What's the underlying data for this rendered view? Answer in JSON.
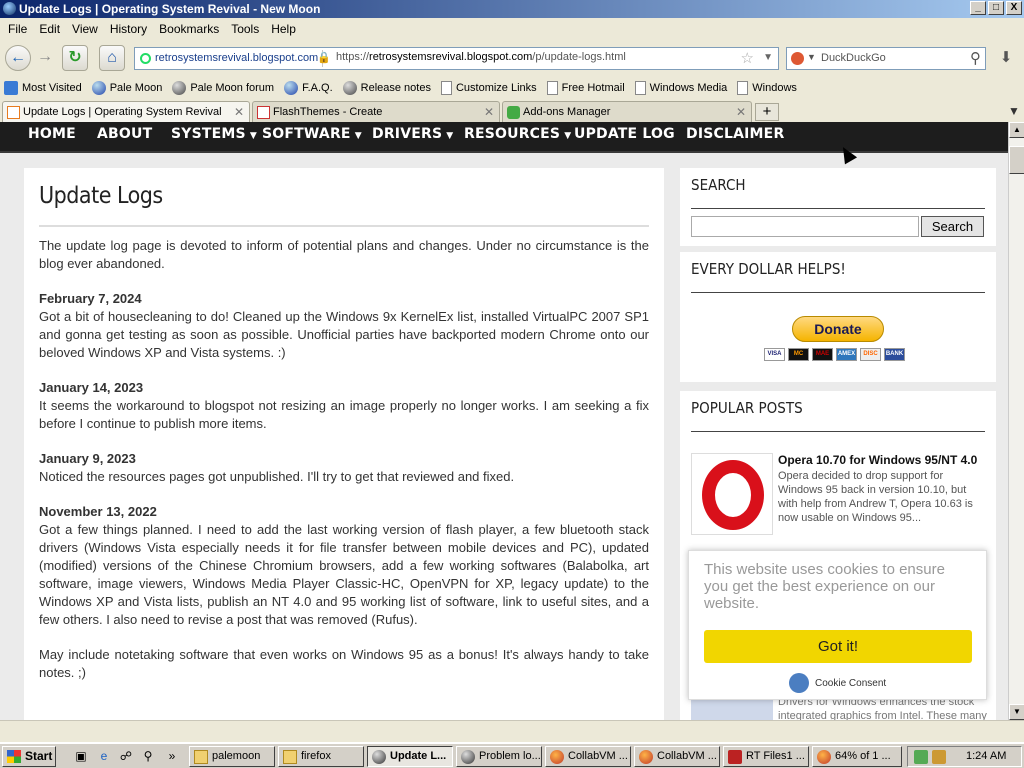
{
  "window": {
    "title": "Update Logs | Operating System Revival - New Moon",
    "min": "_",
    "max": "□",
    "close": "X"
  },
  "menu": [
    "File",
    "Edit",
    "View",
    "History",
    "Bookmarks",
    "Tools",
    "Help"
  ],
  "nav": {
    "identity": "retrosystemsrevival.blogspot.com",
    "url_prefix": "https://",
    "url_host": "retrosystemsrevival.blogspot.com",
    "url_path": "/p/update-logs.html",
    "search_placeholder": "DuckDuckGo"
  },
  "bookmarks": [
    "Most Visited",
    "Pale Moon",
    "Pale Moon forum",
    "F.A.Q.",
    "Release notes",
    "Customize Links",
    "Free Hotmail",
    "Windows Media",
    "Windows"
  ],
  "tabs": [
    {
      "label": "Update Logs | Operating System Revival"
    },
    {
      "label": "FlashThemes - Create"
    },
    {
      "label": "Add-ons Manager"
    }
  ],
  "site_nav": [
    "HOME",
    "ABOUT",
    "SYSTEMS",
    "SOFTWARE",
    "DRIVERS",
    "RESOURCES",
    "UPDATE LOG",
    "DISCLAIMER"
  ],
  "post": {
    "title": "Update Logs",
    "intro": "The update log page is devoted to inform of potential plans and changes. Under no circumstance is the blog ever abandoned.",
    "entries": [
      {
        "date": "February 7, 2024",
        "text": "Got a bit of housecleaning to do! Cleaned up the Windows 9x KernelEx list, installed VirtualPC 2007 SP1 and gonna get testing as soon as possible. Unofficial parties have backported modern Chrome onto our beloved Windows XP and Vista systems. :)"
      },
      {
        "date": "January 14, 2023",
        "text": "It seems the workaround to blogspot not resizing an image properly no longer works. I am seeking a fix before I continue to publish more items."
      },
      {
        "date": "January 9, 2023",
        "text": "Noticed the resources pages got unpublished. I'll try to get that reviewed and fixed."
      },
      {
        "date": "November 13, 2022",
        "text": "Got a few things planned. I need to add the last working version of flash player, a few bluetooth stack drivers (Windows Vista especially needs it for file transfer between mobile devices and PC), updated (modified) versions of the Chinese Chromium browsers, add a few working softwares (Balabolka, art software, image viewers, Windows Media Player Classic-HC, OpenVPN for XP, legacy update) to the Windows XP and Vista lists, publish an NT 4.0 and 95 working list of software, link to useful sites, and a few others. I also need to revise a post that was removed (Rufus)."
      }
    ],
    "extra": "May include notetaking software that even works on Windows 95 as a bonus! It's always handy to take notes. ;)"
  },
  "sidebar": {
    "search_title": "SEARCH",
    "search_button": "Search",
    "donate_title": "EVERY DOLLAR HELPS!",
    "donate_button": "Donate",
    "cards": [
      "VISA",
      "MC",
      "MAE",
      "AMEX",
      "DISC",
      "BANK"
    ],
    "popular_title": "POPULAR POSTS",
    "popular": [
      {
        "title": "Opera 10.70 for Windows 95/NT 4.0",
        "desc": "Opera decided to drop support for Windows 95 back in version 10.10, but with help from Andrew T, Opera 10.63 is now usable on Windows 95..."
      },
      {
        "desc": "Drivers for Windows enhances the stock integrated graphics from Intel. These many"
      }
    ]
  },
  "cookie": {
    "message": "This website uses cookies to ensure you get the best experience on our website.",
    "button": "Got it!",
    "brand": "Cookie Consent"
  },
  "taskbar": {
    "start": "Start",
    "tasks": [
      "palemoon",
      "firefox",
      "Update L...",
      "Problem lo...",
      "CollabVM ...",
      "CollabVM ...",
      "RT Files1 ...",
      "64% of 1 ..."
    ],
    "clock": "1:24 AM"
  }
}
